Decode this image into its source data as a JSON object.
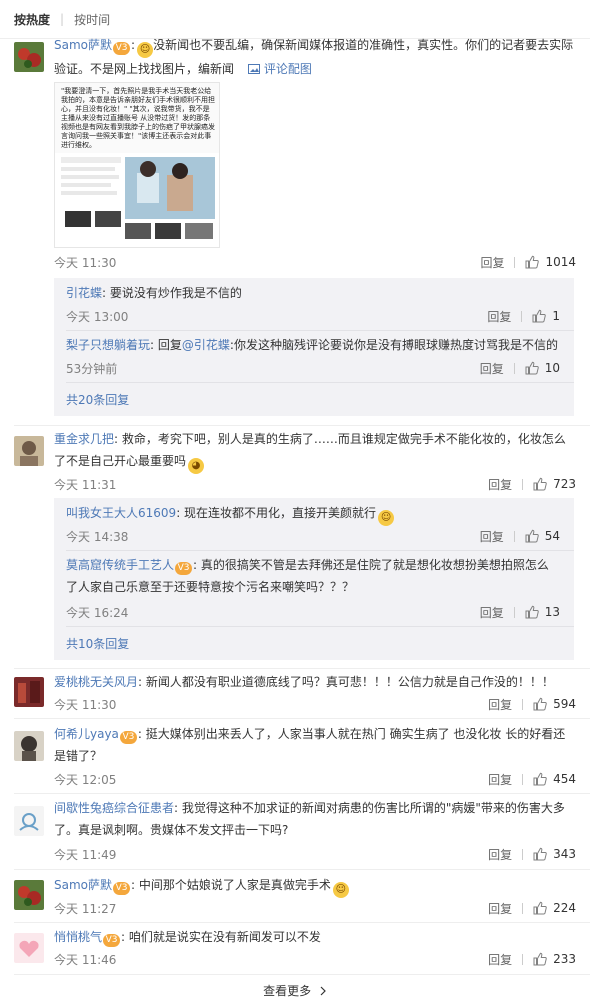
{
  "sort": {
    "hot_label": "按热度",
    "time_label": "按时间"
  },
  "comments": [
    {
      "user": "Samo萨默",
      "badge": "V3",
      "text": "没新闻也不要乱编，确保新闻媒体报道的准确性，真实性。你们的记者要去实际验证。不是网上找找图片，编新闻",
      "image_link": "评论配图",
      "image_text": "\"我要澄清一下，首先照片是我手术当天我老公给我拍的，本意是告诉亲朋好友们手术很顺利不用担心，并且没有化妆！\" \"其次，说我带货，我不是主播从来没有过直播账号 从没带过货！发的那条视频也是有网友看到我脖子上的伤疤了甲状腺癌发言询问我一些照关事宜！\"该博主还表示会对此事进行维权。",
      "time": "今天 11:30",
      "reply_label": "回复",
      "likes": "1014",
      "replies": [
        {
          "user": "引花蝶",
          "text": "要说没有炒作我是不信的",
          "time": "今天 13:00",
          "reply_label": "回复",
          "likes": "1"
        },
        {
          "user": "梨子只想躺着玩",
          "reply_word": "回复",
          "mention": "@引花蝶",
          "text": ":你发这种脑残评论要说你是没有搏眼球赚热度讨骂我是不信的",
          "time": "53分钟前",
          "reply_label": "回复",
          "likes": "10"
        }
      ],
      "more_replies": "共20条回复"
    },
    {
      "user": "重金求几把",
      "text": "救命，考究下吧，别人是真的生病了……而且谁规定做完手术不能化妆的，化妆怎么了不是自己开心最重要吗",
      "time": "今天 11:31",
      "reply_label": "回复",
      "likes": "723",
      "replies": [
        {
          "user": "叫我女王大人61609",
          "text": "现在连妆都不用化，直接开美颜就行",
          "time": "今天 14:38",
          "reply_label": "回复",
          "likes": "54"
        },
        {
          "user": "莫高窟传统手工艺人",
          "badge": "V3",
          "text": "真的很搞笑不管是去拜佛还是住院了就是想化妆想扮美想拍照怎么了人家自己乐意至于还要特意按个污名来嘲笑吗？？？",
          "time": "今天 16:24",
          "reply_label": "回复",
          "likes": "13"
        }
      ],
      "more_replies": "共10条回复"
    },
    {
      "user": "爱桃桃无关风月",
      "text": "新闻人都没有职业道德底线了吗？真可悲！！！公信力就是自己作没的！！！",
      "time": "今天 11:30",
      "reply_label": "回复",
      "likes": "594"
    },
    {
      "user": "何希儿yaya",
      "badge": "V3",
      "text": "挺大媒体别出来丢人了，人家当事人就在热门 确实生病了 也没化妆 长的好看还是错了？",
      "time": "今天 12:05",
      "reply_label": "回复",
      "likes": "454"
    },
    {
      "user": "间歇性兔癌综合征患者",
      "text": "我觉得这种不加求证的新闻对病患的伤害比所谓的\"病媛\"带来的伤害大多了。真是讽刺啊。贵媒体不发文抨击一下吗?",
      "time": "今天 11:49",
      "reply_label": "回复",
      "likes": "343"
    },
    {
      "user": "Samo萨默",
      "badge": "V3",
      "text": "中间那个姑娘说了人家是真做完手术",
      "time": "今天 11:27",
      "reply_label": "回复",
      "likes": "224"
    },
    {
      "user": "悄悄桃气",
      "badge": "V3",
      "text": "咱们就是说实在没有新闻发可以不发",
      "time": "今天 11:46",
      "reply_label": "回复",
      "likes": "233"
    }
  ],
  "see_more": "查看更多",
  "icons": {
    "like": "thumb-up-icon",
    "picture": "picture-icon",
    "chevron": "chevron-right-icon",
    "laugh": "laugh-emoji-icon",
    "shy": "shy-emoji-icon"
  },
  "colors": {
    "link": "#4e79b6",
    "badge": "#f4a73c",
    "subbox_bg": "#f2f2f5"
  }
}
